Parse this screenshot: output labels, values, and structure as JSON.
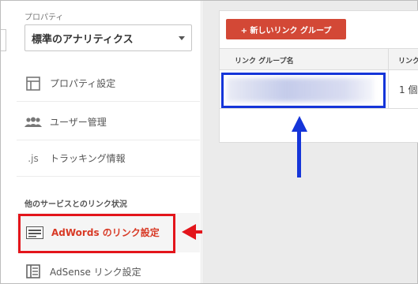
{
  "sidebar": {
    "property_label": "プロパティ",
    "property_select_value": "標準のアナリティクス",
    "items": [
      {
        "label": "プロパティ設定",
        "icon": "property-settings-icon"
      },
      {
        "label": "ユーザー管理",
        "icon": "users-icon"
      },
      {
        "label": "トラッキング情報",
        "icon": "js-icon",
        "icon_text": ".js"
      }
    ],
    "section_header": "他のサービスとのリンク状況",
    "link_items": [
      {
        "label": "AdWords のリンク設定",
        "icon": "adwords-icon",
        "active": true
      },
      {
        "label": "AdSense リンク設定",
        "icon": "adsense-icon"
      }
    ]
  },
  "main": {
    "new_button_label": "+ 新しいリンク グループ",
    "table": {
      "headers": [
        "リンク グループ名",
        "リンク"
      ],
      "rows": [
        {
          "name": "",
          "count": "1 個"
        }
      ]
    }
  },
  "colors": {
    "accent_red": "#d34836",
    "annotation_red": "#e3151b",
    "annotation_blue": "#1535d9"
  }
}
